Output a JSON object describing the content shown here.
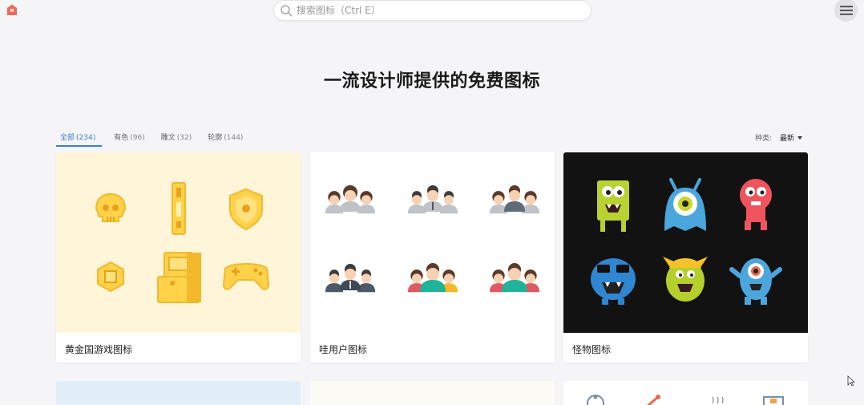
{
  "search": {
    "placeholder": "搜索图标（Ctrl E）"
  },
  "hero": {
    "title": "一流设计师提供的免费图标"
  },
  "tabs": [
    {
      "label": "全部",
      "count": "(234)",
      "active": true
    },
    {
      "label": "有色",
      "count": "(96)"
    },
    {
      "label": "雕文",
      "count": "(32)"
    },
    {
      "label": "轮廓",
      "count": "(144)"
    }
  ],
  "sort": {
    "label": "种类:",
    "value": "最新"
  },
  "cards": [
    {
      "title": "黄金国游戏图标",
      "icons": [
        "skull-icon",
        "tall-tower-icon",
        "shield-icon",
        "coin-icon",
        "arcade-machine-icon",
        "gamepad-icon"
      ]
    },
    {
      "title": "哇用户图标",
      "icons": [
        "women-group-icon",
        "men-group-icon",
        "mixed-group-icon",
        "businessmen-group-icon",
        "colorful-group-icon",
        "family-group-icon"
      ]
    },
    {
      "title": "怪物图标",
      "icons": [
        "green-monster-icon",
        "blue-cyclops-monster-icon",
        "pink-monster-icon",
        "blue-sunglasses-monster-icon",
        "green-horned-monster-icon",
        "blue-one-eyed-monster-icon"
      ]
    }
  ],
  "colors": {
    "accent": "#3d7bd8",
    "logo": "#ee6b5b",
    "gold": "#ffd24a",
    "dark_card": "#121212"
  }
}
